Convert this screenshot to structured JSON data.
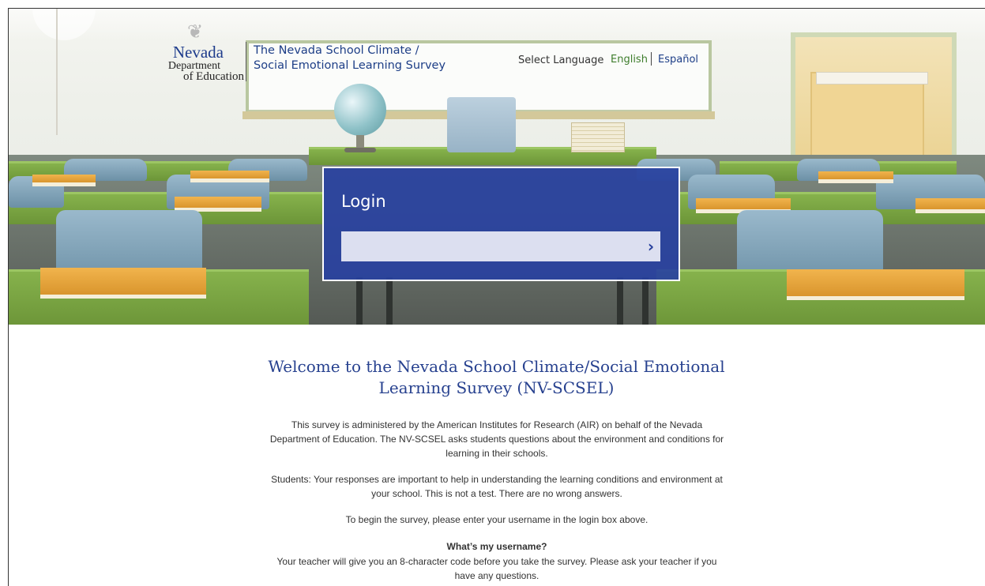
{
  "header": {
    "logo": {
      "line1": "Nevada",
      "line2": "Department",
      "line3": "of Education"
    },
    "site_title_line1": "The Nevada School Climate /",
    "site_title_line2": "Social Emotional Learning Survey",
    "language": {
      "label": "Select Language",
      "options": [
        "English",
        "Español"
      ],
      "selected": "English"
    }
  },
  "login": {
    "title": "Login",
    "username_value": "",
    "submit_icon": "chevron-right-icon"
  },
  "main": {
    "welcome_heading": "Welcome to the Nevada School Climate/Social Emotional Learning Survey (NV-SCSEL)",
    "para1": "This survey is administered by the American Institutes for Research (AIR) on behalf of the Nevada Department of Education. The NV-SCSEL asks students questions about the environment and conditions for learning in their schools.",
    "para2": "Students: Your responses are important to help in understanding the learning conditions and environment at your school. This is not a test. There are no wrong answers.",
    "para3": "To begin the survey, please enter your username in the login box above.",
    "faq_question": "What’s my username?",
    "faq_answer": "Your teacher will give you an 8-character code before you take the survey. Please ask your teacher if you have any questions."
  },
  "colors": {
    "brand_blue": "#1d3e87",
    "login_panel": "#2841a0",
    "english_link": "#3e7d2c"
  }
}
